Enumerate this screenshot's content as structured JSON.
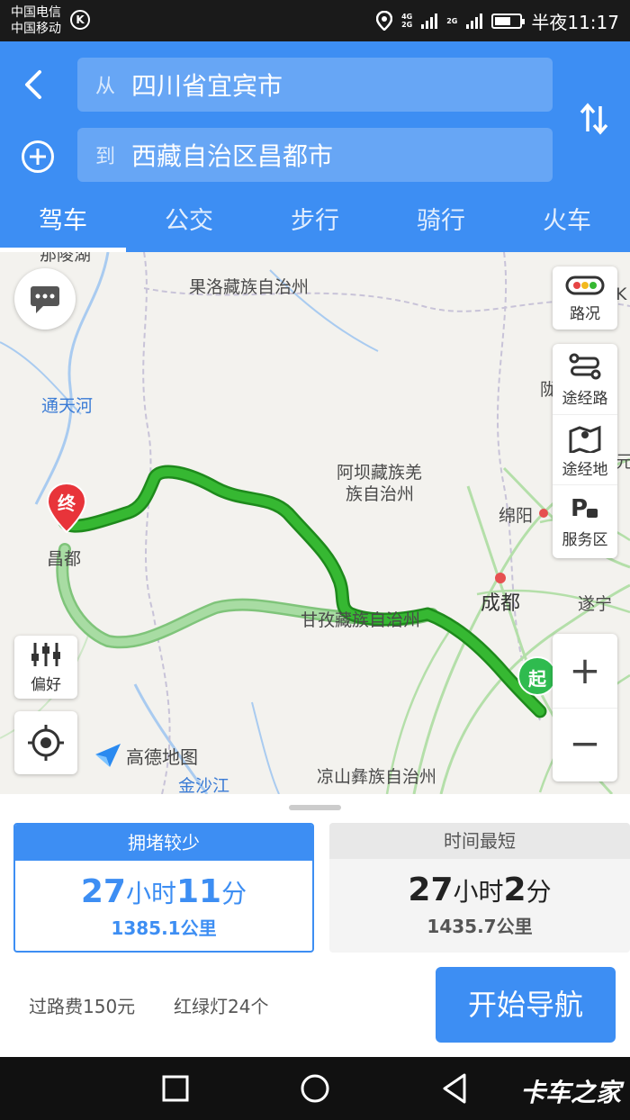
{
  "status_bar": {
    "carriers": [
      "中国电信",
      "中国移动"
    ],
    "carrier_badge": "K",
    "net_labels": [
      "4G",
      "2G",
      "2G"
    ],
    "time": "半夜11:17"
  },
  "header": {
    "from_prefix": "从",
    "from_value": "四川省宜宾市",
    "to_prefix": "到",
    "to_value": "西藏自治区昌都市",
    "back_icon": "chevron-left-icon",
    "add_icon": "plus-circle-icon",
    "swap_icon": "swap-vertical-icon"
  },
  "tabs": [
    {
      "label": "驾车",
      "active": true
    },
    {
      "label": "公交",
      "active": false
    },
    {
      "label": "步行",
      "active": false
    },
    {
      "label": "骑行",
      "active": false
    },
    {
      "label": "火车",
      "active": false
    }
  ],
  "map": {
    "labels": {
      "top_partial": "那陵湖",
      "golog": "果洛藏族自治州",
      "tongtian": "通天河",
      "aba_1": "阿坝藏族羌",
      "aba_2": "族自治州",
      "mianyang": "绵阳",
      "changdu": "昌都",
      "ganzi": "甘孜藏族自治州",
      "chengdu": "成都",
      "suining": "遂宁",
      "liangshan": "凉山彝族自治州",
      "jinsha": "金沙江",
      "long": "陇",
      "yuan": "元",
      "k_edge": "K"
    },
    "pins": {
      "end": "终",
      "start": "起"
    },
    "controls": {
      "traffic": "路况",
      "waypoint_road": "途经路",
      "waypoint_place": "途经地",
      "service_area": "服务区",
      "preference": "偏好",
      "zoom_in": "+",
      "zoom_out": "−"
    },
    "logo": "高德地图"
  },
  "routes": [
    {
      "tag": "拥堵较少",
      "hours": "27",
      "hour_unit": "小时",
      "minutes": "11",
      "minute_unit": "分",
      "distance": "1385.1公里",
      "selected": true
    },
    {
      "tag": "时间最短",
      "hours": "27",
      "hour_unit": "小时",
      "minutes": "2",
      "minute_unit": "分",
      "distance": "1435.7公里",
      "selected": false
    }
  ],
  "summary": {
    "toll": "过路费150元",
    "traffic_lights": "红绿灯24个"
  },
  "start_nav": "开始导航",
  "watermark": "卡车之家",
  "colors": {
    "accent": "#3d8ef3",
    "route_main": "#27a524",
    "route_alt": "#9fd49a",
    "end_pin": "#e8343a",
    "start_pin": "#2fbb4f"
  }
}
